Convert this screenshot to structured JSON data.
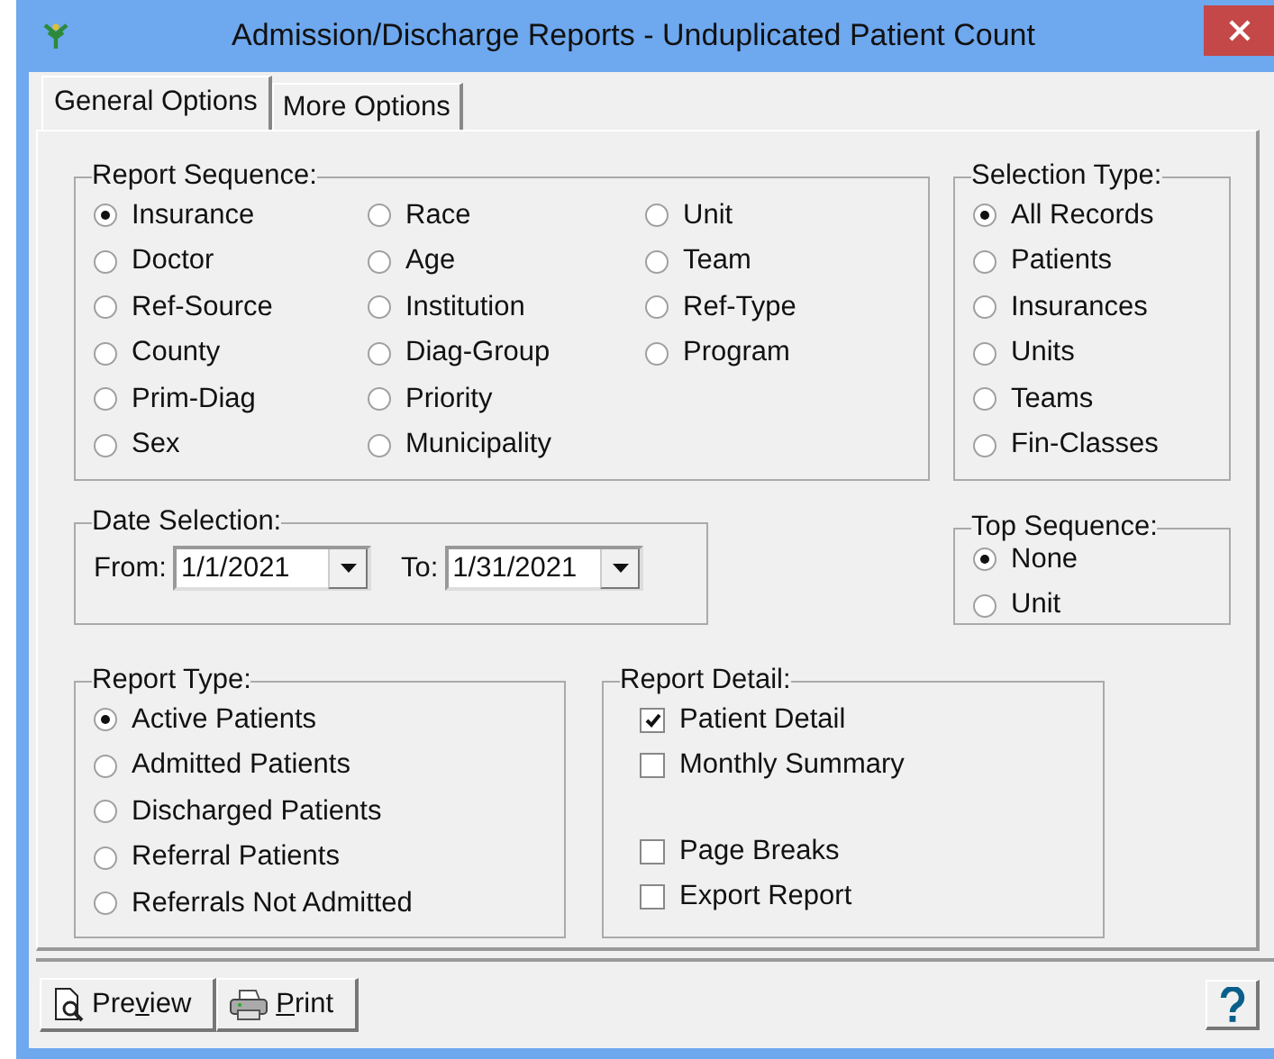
{
  "window": {
    "title": "Admission/Discharge Reports - Unduplicated Patient Count"
  },
  "tabs": [
    {
      "label": "General Options",
      "selected": true
    },
    {
      "label": "More Options",
      "selected": false
    }
  ],
  "report_sequence": {
    "title": "Report Sequence:",
    "columns": [
      [
        {
          "label": "Insurance",
          "selected": true
        },
        {
          "label": "Doctor",
          "selected": false
        },
        {
          "label": "Ref-Source",
          "selected": false
        },
        {
          "label": "County",
          "selected": false
        },
        {
          "label": "Prim-Diag",
          "selected": false
        },
        {
          "label": "Sex",
          "selected": false
        }
      ],
      [
        {
          "label": "Race",
          "selected": false
        },
        {
          "label": "Age",
          "selected": false
        },
        {
          "label": "Institution",
          "selected": false
        },
        {
          "label": "Diag-Group",
          "selected": false
        },
        {
          "label": "Priority",
          "selected": false
        },
        {
          "label": "Municipality",
          "selected": false
        }
      ],
      [
        {
          "label": "Unit",
          "selected": false
        },
        {
          "label": "Team",
          "selected": false
        },
        {
          "label": "Ref-Type",
          "selected": false
        },
        {
          "label": "Program",
          "selected": false
        }
      ]
    ]
  },
  "selection_type": {
    "title": "Selection Type:",
    "options": [
      {
        "label": "All Records",
        "selected": true
      },
      {
        "label": "Patients",
        "selected": false
      },
      {
        "label": "Insurances",
        "selected": false
      },
      {
        "label": "Units",
        "selected": false
      },
      {
        "label": "Teams",
        "selected": false
      },
      {
        "label": "Fin-Classes",
        "selected": false
      }
    ]
  },
  "date_selection": {
    "title": "Date Selection:",
    "fields": [
      {
        "label": "From:",
        "value": "1/1/2021"
      },
      {
        "label": "To:",
        "value": "1/31/2021"
      }
    ]
  },
  "top_sequence": {
    "title": "Top Sequence:",
    "options": [
      {
        "label": "None",
        "selected": true
      },
      {
        "label": "Unit",
        "selected": false
      }
    ]
  },
  "report_type": {
    "title": "Report Type:",
    "options": [
      {
        "label": "Active Patients",
        "selected": true
      },
      {
        "label": "Admitted Patients",
        "selected": false
      },
      {
        "label": "Discharged Patients",
        "selected": false
      },
      {
        "label": "Referral Patients",
        "selected": false
      },
      {
        "label": "Referrals Not Admitted",
        "selected": false
      }
    ]
  },
  "report_detail": {
    "title": "Report Detail:",
    "option_groups": [
      [
        {
          "label": "Patient Detail",
          "checked": true
        },
        {
          "label": "Monthly Summary",
          "checked": false
        }
      ],
      [
        {
          "label": "Page Breaks",
          "checked": false
        },
        {
          "label": "Export Report",
          "checked": false
        }
      ]
    ]
  },
  "toolbar": {
    "buttons": [
      {
        "kind": "preview",
        "text_before": "Pre",
        "access_key": "v",
        "text_after": "iew"
      },
      {
        "kind": "print",
        "access_key": "P",
        "text_after": "rint"
      }
    ]
  }
}
